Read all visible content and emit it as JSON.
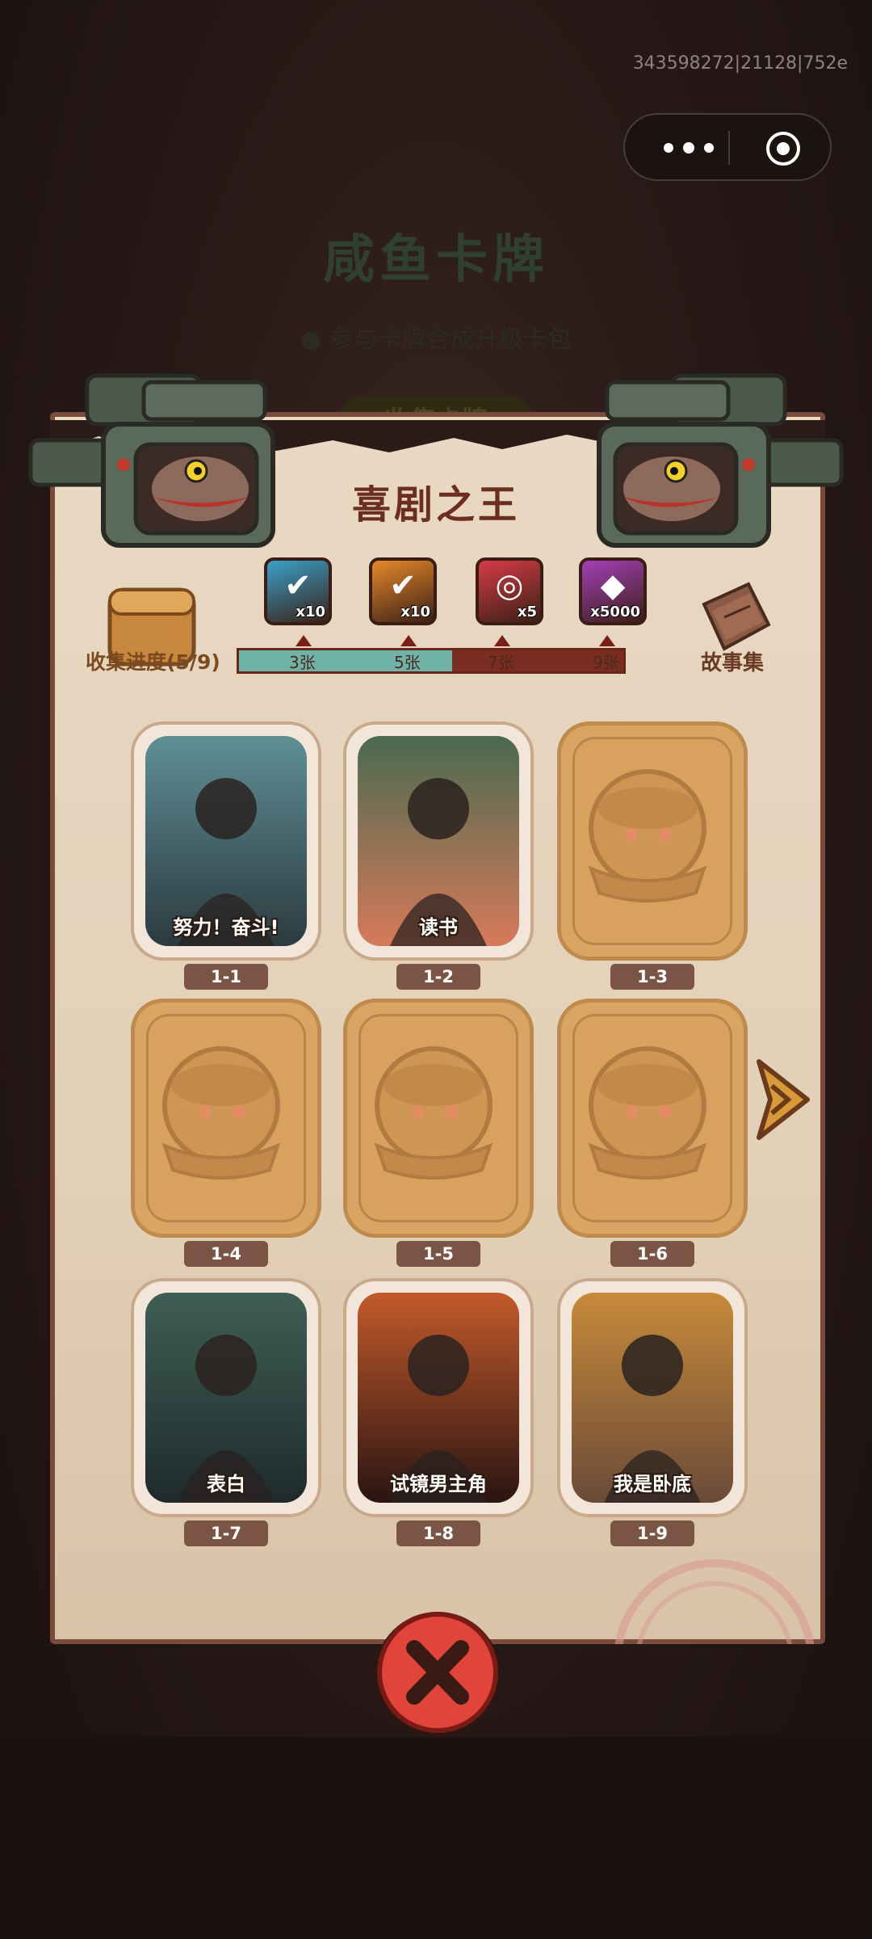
{
  "status": {
    "build_id": "343598272|21128|752e"
  },
  "capsule": {
    "more_icon": "more-dots-icon",
    "close_icon": "target-ring-icon"
  },
  "background": {
    "title": "咸鱼卡牌",
    "subtitle": "● 参与卡牌合成升级卡包",
    "button": "收集卡牌"
  },
  "panel": {
    "title": "喜剧之王",
    "progress_label": "收集进度(5/9)",
    "progress": {
      "collected": 5,
      "total": 9
    },
    "story_label": "故事集",
    "rewards": [
      {
        "icon": "green-check-ticket-icon",
        "qty": "x10",
        "threshold": "3张",
        "color": "#3aa0c9"
      },
      {
        "icon": "orange-check-ticket-icon",
        "qty": "x10",
        "threshold": "5张",
        "color": "#e7892a"
      },
      {
        "icon": "rainbow-swirl-icon",
        "qty": "x5",
        "threshold": "7张",
        "color": "#d63b46"
      },
      {
        "icon": "crystal-gem-icon",
        "qty": "x5000",
        "threshold": "9张",
        "color": "#a53fb8"
      }
    ],
    "cards": [
      {
        "id": "1-1",
        "label": "努力！奋斗!",
        "unlocked": true
      },
      {
        "id": "1-2",
        "label": "读书",
        "unlocked": true
      },
      {
        "id": "1-3",
        "label": "",
        "unlocked": false
      },
      {
        "id": "1-4",
        "label": "",
        "unlocked": false
      },
      {
        "id": "1-5",
        "label": "",
        "unlocked": false
      },
      {
        "id": "1-6",
        "label": "",
        "unlocked": false
      },
      {
        "id": "1-7",
        "label": "表白",
        "unlocked": true
      },
      {
        "id": "1-8",
        "label": "试镜男主角",
        "unlocked": true
      },
      {
        "id": "1-9",
        "label": "我是卧底",
        "unlocked": true
      }
    ]
  },
  "close_button": {
    "icon": "close-x-icon"
  }
}
